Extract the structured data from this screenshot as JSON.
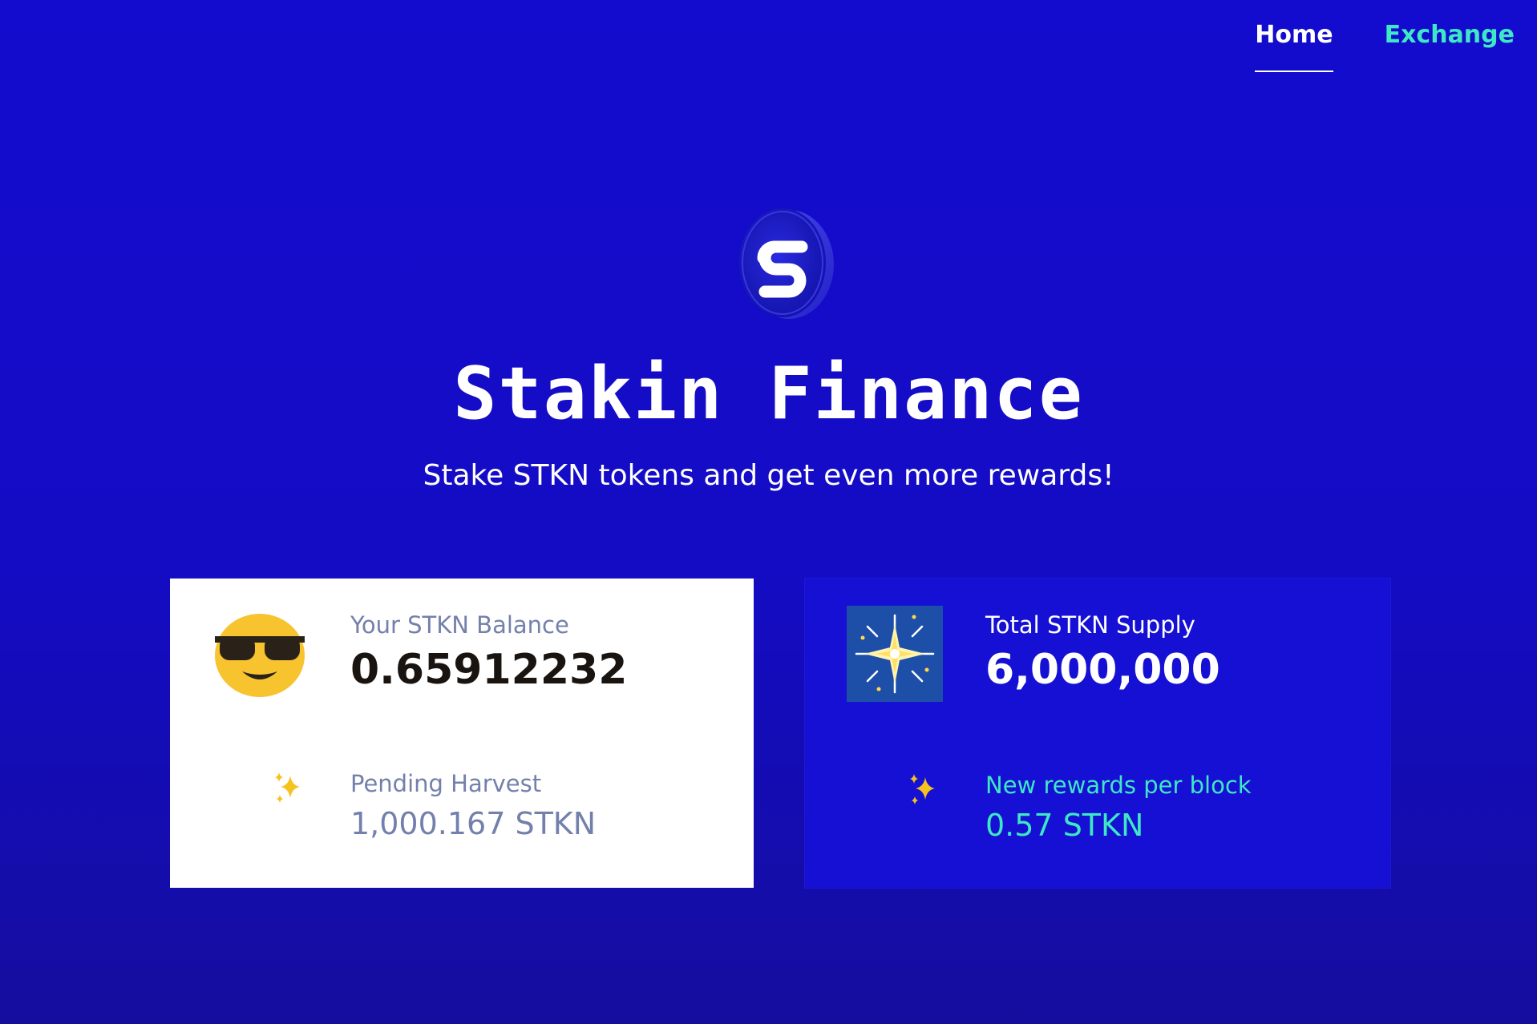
{
  "nav": {
    "home_label": "Home",
    "exchange_label": "Exchange"
  },
  "hero": {
    "title": "Stakin Finance",
    "subtitle": "Stake STKN tokens and get even more rewards!"
  },
  "balance_card": {
    "icon": "sunglasses-emoji-icon",
    "balance_label": "Your STKN Balance",
    "balance_value": "0.65912232",
    "pending_icon": "sparkles-icon",
    "pending_label": "Pending Harvest",
    "pending_value": "1,000.167 STKN"
  },
  "supply_card": {
    "icon": "fireworks-icon",
    "supply_label": "Total STKN Supply",
    "supply_value": "6,000,000",
    "rewards_icon": "sparkles-icon",
    "rewards_label": "New rewards per block",
    "rewards_value": "0.57 STKN"
  },
  "colors": {
    "background": "#140cc4",
    "accent": "#3ee8c4",
    "card_light": "#ffffff",
    "card_dark": "#1510d4",
    "muted_text": "#7480ac"
  }
}
